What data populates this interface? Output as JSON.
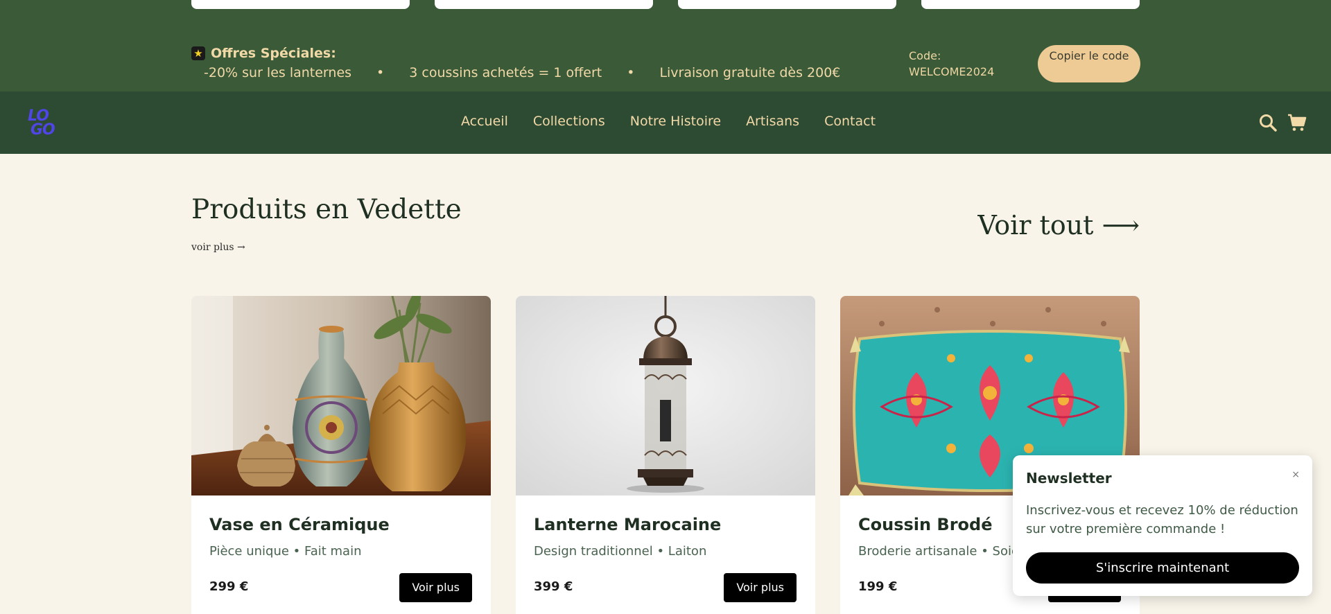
{
  "promo": {
    "title": "Offres Spéciales:",
    "offers": [
      "-20% sur les lanternes",
      "3 coussins achetés = 1 offert",
      "Livraison gratuite dès 200€"
    ],
    "separator": "•",
    "code_label": "Code:",
    "code_value": "WELCOME2024",
    "copy_button": "Copier le code"
  },
  "nav": {
    "logo": [
      "LO",
      "GO"
    ],
    "links": [
      "Accueil",
      "Collections",
      "Notre Histoire",
      "Artisans",
      "Contact"
    ],
    "icons": [
      "search-icon",
      "cart-icon"
    ]
  },
  "section": {
    "title": "Produits en Vedette",
    "more": "voir plus →",
    "see_all": "Voir tout ⟶"
  },
  "products": [
    {
      "name": "Vase en Céramique",
      "desc": "Pièce unique • Fait main",
      "price": "299 €",
      "button": "Voir plus"
    },
    {
      "name": "Lanterne Marocaine",
      "desc": "Design traditionnel • Laiton",
      "price": "399 €",
      "button": "Voir plus"
    },
    {
      "name": "Coussin Brodé",
      "desc": "Broderie artisanale • Soie",
      "price": "199 €",
      "button": "Voir plus"
    }
  ],
  "newsletter": {
    "title": "Newsletter",
    "close": "×",
    "text": "Inscrivez-vous et recevez 10% de réduction sur votre première commande !",
    "button": "S'inscrire maintenant"
  },
  "colors": {
    "promo_bg": "#3a5a38",
    "nav_bg": "#2d4a32",
    "page_bg": "#f8f4ea",
    "accent": "#eecb95",
    "logo": "#4f46e5"
  }
}
